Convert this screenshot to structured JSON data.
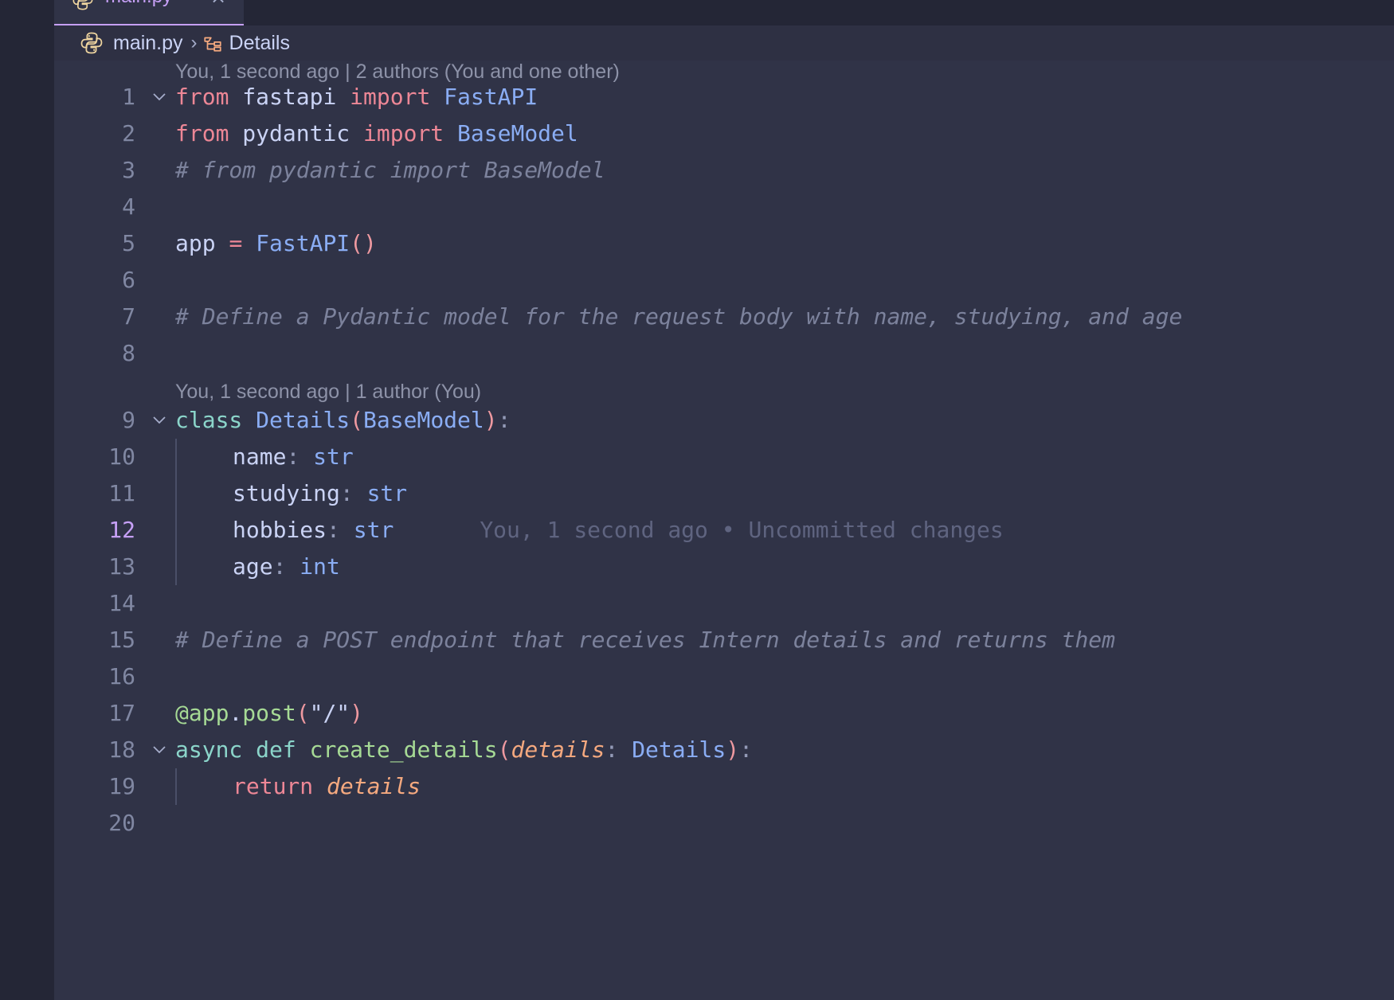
{
  "tab": {
    "label": "main.py",
    "close": "×",
    "accent": "#c6a0f6"
  },
  "breadcrumb": {
    "file": "main.py",
    "separator": "›",
    "symbol": "Details"
  },
  "code_lens": {
    "first": "You, 1 second ago | 2 authors (You and one other)",
    "second": "You, 1 second ago | 1 author (You)"
  },
  "lines": {
    "l1": {
      "num": "1",
      "t": [
        "from",
        " fastapi ",
        "import",
        " ",
        "FastAPI"
      ]
    },
    "l2": {
      "num": "2",
      "t": [
        "from",
        " pydantic ",
        "import",
        " ",
        "BaseModel"
      ]
    },
    "l3": {
      "num": "3",
      "t": [
        "# from pydantic import BaseModel"
      ]
    },
    "l4": {
      "num": "4"
    },
    "l5": {
      "num": "5",
      "t": [
        "app ",
        "=",
        " ",
        "FastAPI",
        "()"
      ]
    },
    "l6": {
      "num": "6"
    },
    "l7": {
      "num": "7",
      "t": [
        "# Define a Pydantic model for the request body with name, studying, and age"
      ]
    },
    "l8": {
      "num": "8"
    },
    "l9": {
      "num": "9",
      "t": [
        "class",
        " ",
        "Details",
        "(",
        "BaseModel",
        ")",
        ":"
      ]
    },
    "l10": {
      "num": "10",
      "t": [
        "name",
        ":",
        " ",
        "str"
      ]
    },
    "l11": {
      "num": "11",
      "t": [
        "studying",
        ":",
        " ",
        "str"
      ]
    },
    "l12": {
      "num": "12",
      "t": [
        "hobbies",
        ":",
        " ",
        "str"
      ],
      "blame": "You, 1 second ago • Uncommitted changes"
    },
    "l13": {
      "num": "13",
      "t": [
        "age",
        ":",
        " ",
        "int"
      ]
    },
    "l14": {
      "num": "14"
    },
    "l15": {
      "num": "15",
      "t": [
        "# Define a POST endpoint that receives Intern details and returns them"
      ]
    },
    "l16": {
      "num": "16"
    },
    "l17": {
      "num": "17",
      "t": [
        "@app",
        ".",
        "post",
        "(",
        "\"/\"",
        ")"
      ]
    },
    "l18": {
      "num": "18",
      "t": [
        "async",
        " ",
        "def",
        " ",
        "create_details",
        "(",
        "details",
        ":",
        " ",
        "Details",
        ")",
        ":"
      ]
    },
    "l19": {
      "num": "19",
      "t": [
        "return",
        " ",
        "details"
      ]
    },
    "l20": {
      "num": "20"
    }
  },
  "active_line": "12",
  "icons": {
    "tab": "python-icon",
    "breadcrumb_file": "python-icon",
    "breadcrumb_symbol": "class-symbol-icon",
    "fold": "chevron-down-icon"
  }
}
